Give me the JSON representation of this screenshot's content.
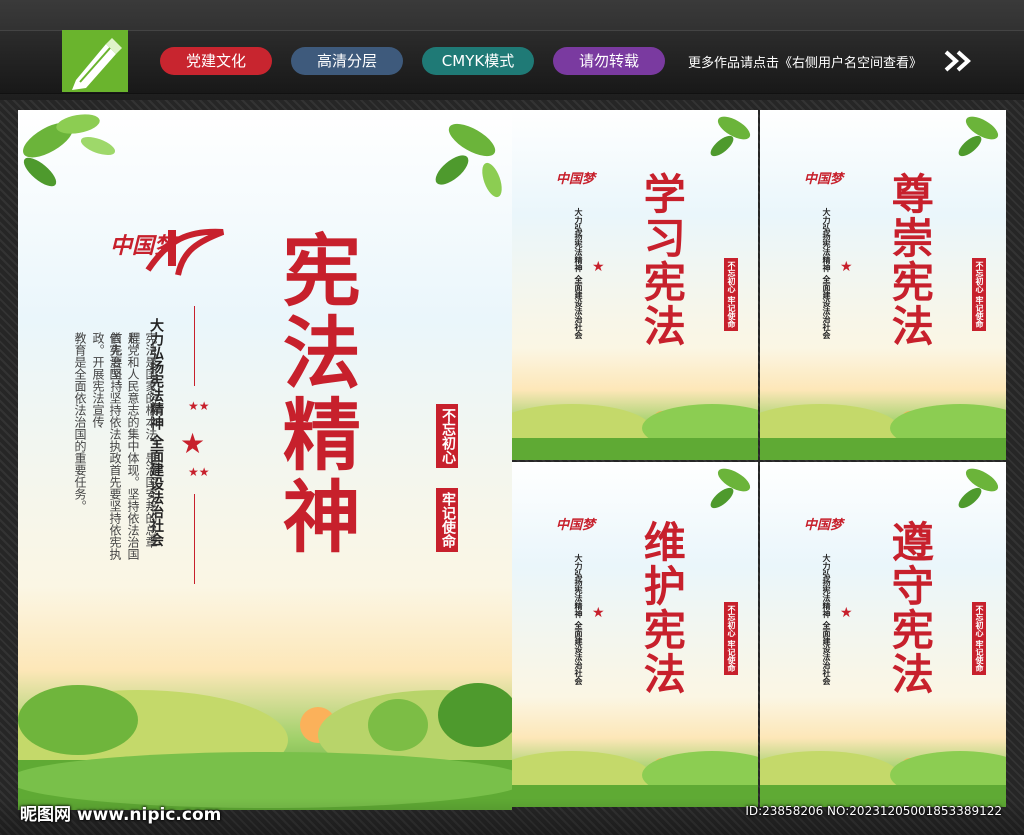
{
  "header": {
    "tags": [
      {
        "label": "党建文化",
        "color": "#c8252f"
      },
      {
        "label": "高清分层",
        "color": "#3e5a7c"
      },
      {
        "label": "CMYK模式",
        "color": "#1f7a76"
      },
      {
        "label": "请勿转载",
        "color": "#7a3aa0"
      }
    ],
    "notice": "更多作品请点击《右侧用户名空间查看》"
  },
  "main_poster": {
    "title": "宪法精神",
    "subtitle": "大力弘扬宪法精神 全面建设法治社会",
    "body": [
      "宪法是国家的根本法，是治国安邦的总章程，",
      "是党和人民意志的集中体现。坚持依法治国首先要坚持",
      "依宪治国，坚持依法执政首先要坚持依宪执政。开展宪法宣传",
      "教育是全面依法治国的重要任务。"
    ],
    "seal_1": "不忘初心",
    "seal_2": "牢记使命",
    "brand_mark": "中国梦"
  },
  "small_posters": [
    {
      "title": "学习宪法",
      "subtitle": "大力弘扬宪法精神 全面建设法治社会",
      "seal": "不忘初心 牢记使命"
    },
    {
      "title": "尊崇宪法",
      "subtitle": "大力弘扬宪法精神 全面建设法治社会",
      "seal": "不忘初心 牢记使命"
    },
    {
      "title": "维护宪法",
      "subtitle": "大力弘扬宪法精神 全面建设法治社会",
      "seal": "不忘初心 牢记使命"
    },
    {
      "title": "遵守宪法",
      "subtitle": "大力弘扬宪法精神 全面建设法治社会",
      "seal": "不忘初心 牢记使命"
    }
  ],
  "footer": {
    "watermark": "昵图网 www.nipic.com",
    "id_text": "ID:23858206 NO:20231205001853389122"
  },
  "colors": {
    "accent": "#c7202c",
    "grass": "#4e9a2d",
    "logo": "#6ab42d"
  }
}
